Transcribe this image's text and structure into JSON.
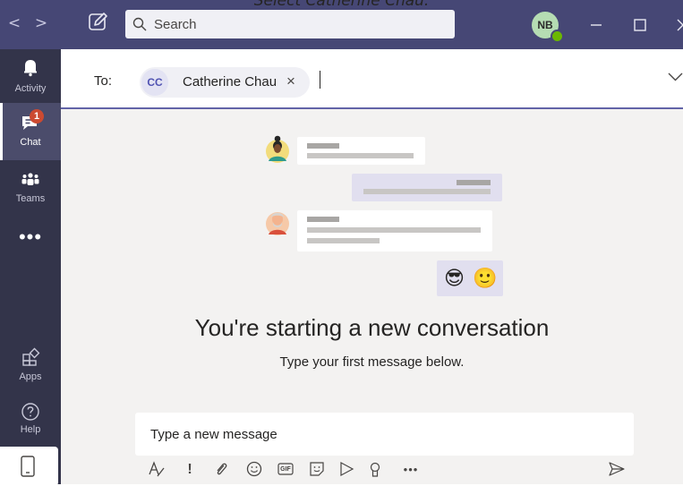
{
  "caption": "Select Catherine Chau.",
  "titlebar": {
    "back_label": "<",
    "forward_label": ">",
    "compose_icon": "compose-icon",
    "search_placeholder": "Search",
    "me_initials": "NB",
    "presence_status": "available",
    "colors": {
      "bar": "#464775",
      "presence": "#6bb700"
    }
  },
  "rail": {
    "items": [
      {
        "label": "Activity",
        "icon": "bell-icon"
      },
      {
        "label": "Chat",
        "icon": "chat-icon",
        "badge": "1",
        "active": true
      },
      {
        "label": "Teams",
        "icon": "teams-icon"
      },
      {
        "label": "•••",
        "icon": "more-icon"
      },
      {
        "label": "Apps",
        "icon": "apps-icon"
      },
      {
        "label": "Help",
        "icon": "help-icon"
      }
    ],
    "mobile_icon": "mobile-icon"
  },
  "to_bar": {
    "label": "To:",
    "recipient": {
      "initials": "CC",
      "name": "Catherine Chau",
      "remove": "×"
    }
  },
  "empty_state": {
    "title": "You're starting a new conversation",
    "subtitle": "Type your first message below.",
    "emoji_1": "😎",
    "emoji_2": "🙂"
  },
  "compose": {
    "placeholder": "Type a new message",
    "toolbar": [
      "format-icon",
      "important-icon",
      "attach-icon",
      "emoji-icon",
      "gif-icon",
      "sticker-icon",
      "meet-now-icon",
      "praise-icon",
      "more-options-icon"
    ],
    "gif_label": "GIF",
    "more_label": "•••",
    "send_icon": "send-icon"
  }
}
